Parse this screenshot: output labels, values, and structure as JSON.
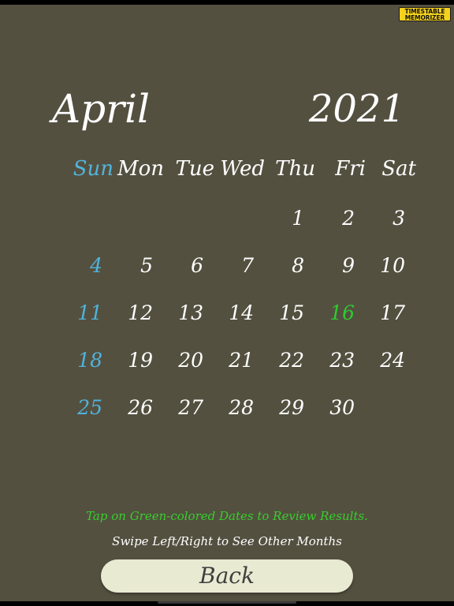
{
  "logo": {
    "line1": "TIMESTABLE",
    "line2": "MEMORIZER"
  },
  "calendar": {
    "month": "April",
    "year": "2021",
    "weekdays": [
      "Sun",
      "Mon",
      "Tue",
      "Wed",
      "Thu",
      "Fri",
      "Sat"
    ],
    "weeks": [
      [
        "",
        "",
        "",
        "",
        "1",
        "2",
        "3"
      ],
      [
        "4",
        "5",
        "6",
        "7",
        "8",
        "9",
        "10"
      ],
      [
        "11",
        "12",
        "13",
        "14",
        "15",
        "16",
        "17"
      ],
      [
        "18",
        "19",
        "20",
        "21",
        "22",
        "23",
        "24"
      ],
      [
        "25",
        "26",
        "27",
        "28",
        "29",
        "30",
        ""
      ]
    ],
    "result_dates": [
      "16"
    ]
  },
  "hints": {
    "green": "Tap on Green-colored Dates to Review Results.",
    "white": "Swipe Left/Right to See Other Months"
  },
  "back_button": {
    "label": "Back"
  },
  "colors": {
    "background": "#545040",
    "sunday": "#52b4dc",
    "result": "#2ecb2e",
    "button": "#e9ead2",
    "logo": "#f4d21c"
  }
}
